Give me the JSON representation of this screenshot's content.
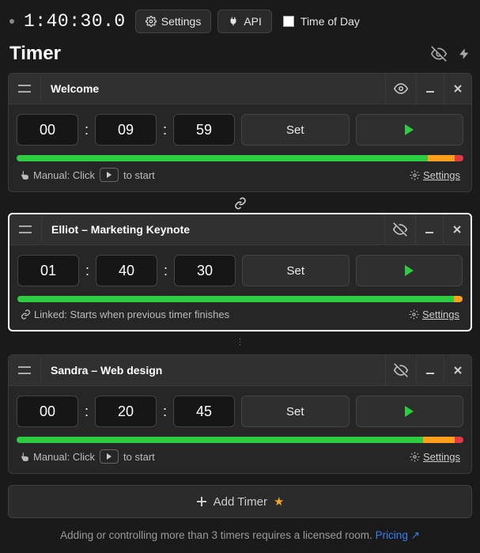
{
  "top": {
    "master_time": "1:40:30.0",
    "settings_label": "Settings",
    "api_label": "API",
    "time_of_day_label": "Time of Day",
    "time_of_day_checked": false
  },
  "section": {
    "title": "Timer"
  },
  "timers": [
    {
      "title": "Welcome",
      "hh": "00",
      "mm": "09",
      "ss": "59",
      "set_label": "Set",
      "selected": false,
      "visibility_icon": "eye",
      "mode_text_before": "Manual: Click",
      "mode_text_after": "to start",
      "mode_icon": "pointer",
      "settings_label": "Settings",
      "progress": {
        "green": 92,
        "orange": 6,
        "red": 2
      }
    },
    {
      "title": "Elliot – Marketing Keynote",
      "hh": "01",
      "mm": "40",
      "ss": "30",
      "set_label": "Set",
      "selected": true,
      "visibility_icon": "eye-off",
      "mode_text_full": "Linked: Starts when previous timer finishes",
      "mode_icon": "link",
      "settings_label": "Settings",
      "progress": {
        "green": 98,
        "orange": 2,
        "red": 0
      }
    },
    {
      "title": "Sandra – Web design",
      "hh": "00",
      "mm": "20",
      "ss": "45",
      "set_label": "Set",
      "selected": false,
      "visibility_icon": "eye-off",
      "mode_text_before": "Manual: Click",
      "mode_text_after": "to start",
      "mode_icon": "pointer",
      "settings_label": "Settings",
      "progress": {
        "green": 91,
        "orange": 7,
        "red": 2
      }
    }
  ],
  "add_timer_label": "Add Timer",
  "notice": {
    "text": "Adding or controlling more than 3 timers requires a licensed room.",
    "pricing_label": "Pricing"
  }
}
